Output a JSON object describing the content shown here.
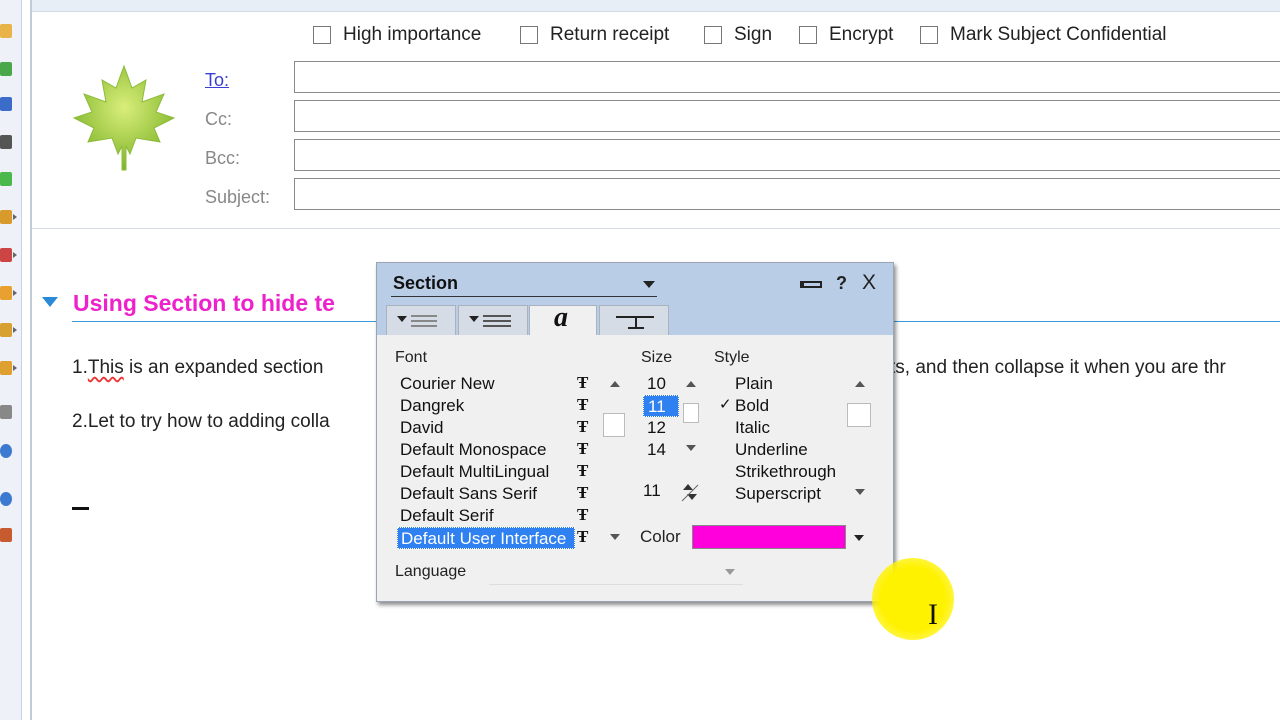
{
  "options": {
    "high_importance": "High importance",
    "return_receipt": "Return receipt",
    "sign": "Sign",
    "encrypt": "Encrypt",
    "mark_confidential": "Mark Subject Confidential"
  },
  "address": {
    "to_label": "To:",
    "cc_label": "Cc:",
    "bcc_label": "Bcc:",
    "subject_label": "Subject:",
    "to_value": "",
    "cc_value": "",
    "bcc_value": "",
    "subject_value": ""
  },
  "body": {
    "section_title": "Using Section to hide te",
    "line1_prefix": "1.",
    "line1_word": "This",
    "line1_rest": " is an expanded section",
    "line1_right": "ts, and then collapse it when you are thr",
    "line2": "2.Let to try how to adding colla"
  },
  "dialog": {
    "title": "Section",
    "help": "?",
    "close": "X",
    "tab_text_glyph": "a",
    "font_label": "Font",
    "size_label": "Size",
    "style_label": "Style",
    "color_label": "Color",
    "language_label": "Language",
    "fonts": [
      "Courier New",
      "Dangrek",
      "David",
      "Default Monospace",
      "Default MultiLingual",
      "Default Sans Serif",
      "Default Serif",
      "Default User Interface"
    ],
    "selected_font": "Default User Interface",
    "sizes": [
      "10",
      "11",
      "12",
      "14"
    ],
    "selected_size": "11",
    "size_value": "11",
    "styles": [
      "Plain",
      "Bold",
      "Italic",
      "Underline",
      "Strikethrough",
      "Superscript"
    ],
    "checked_style": "Bold",
    "color_value": "#ff00dd",
    "language_value": ""
  },
  "colors": {
    "section_title": "#ee22cc",
    "selection": "#2f80f0",
    "dialog_header": "#b9cde6"
  }
}
